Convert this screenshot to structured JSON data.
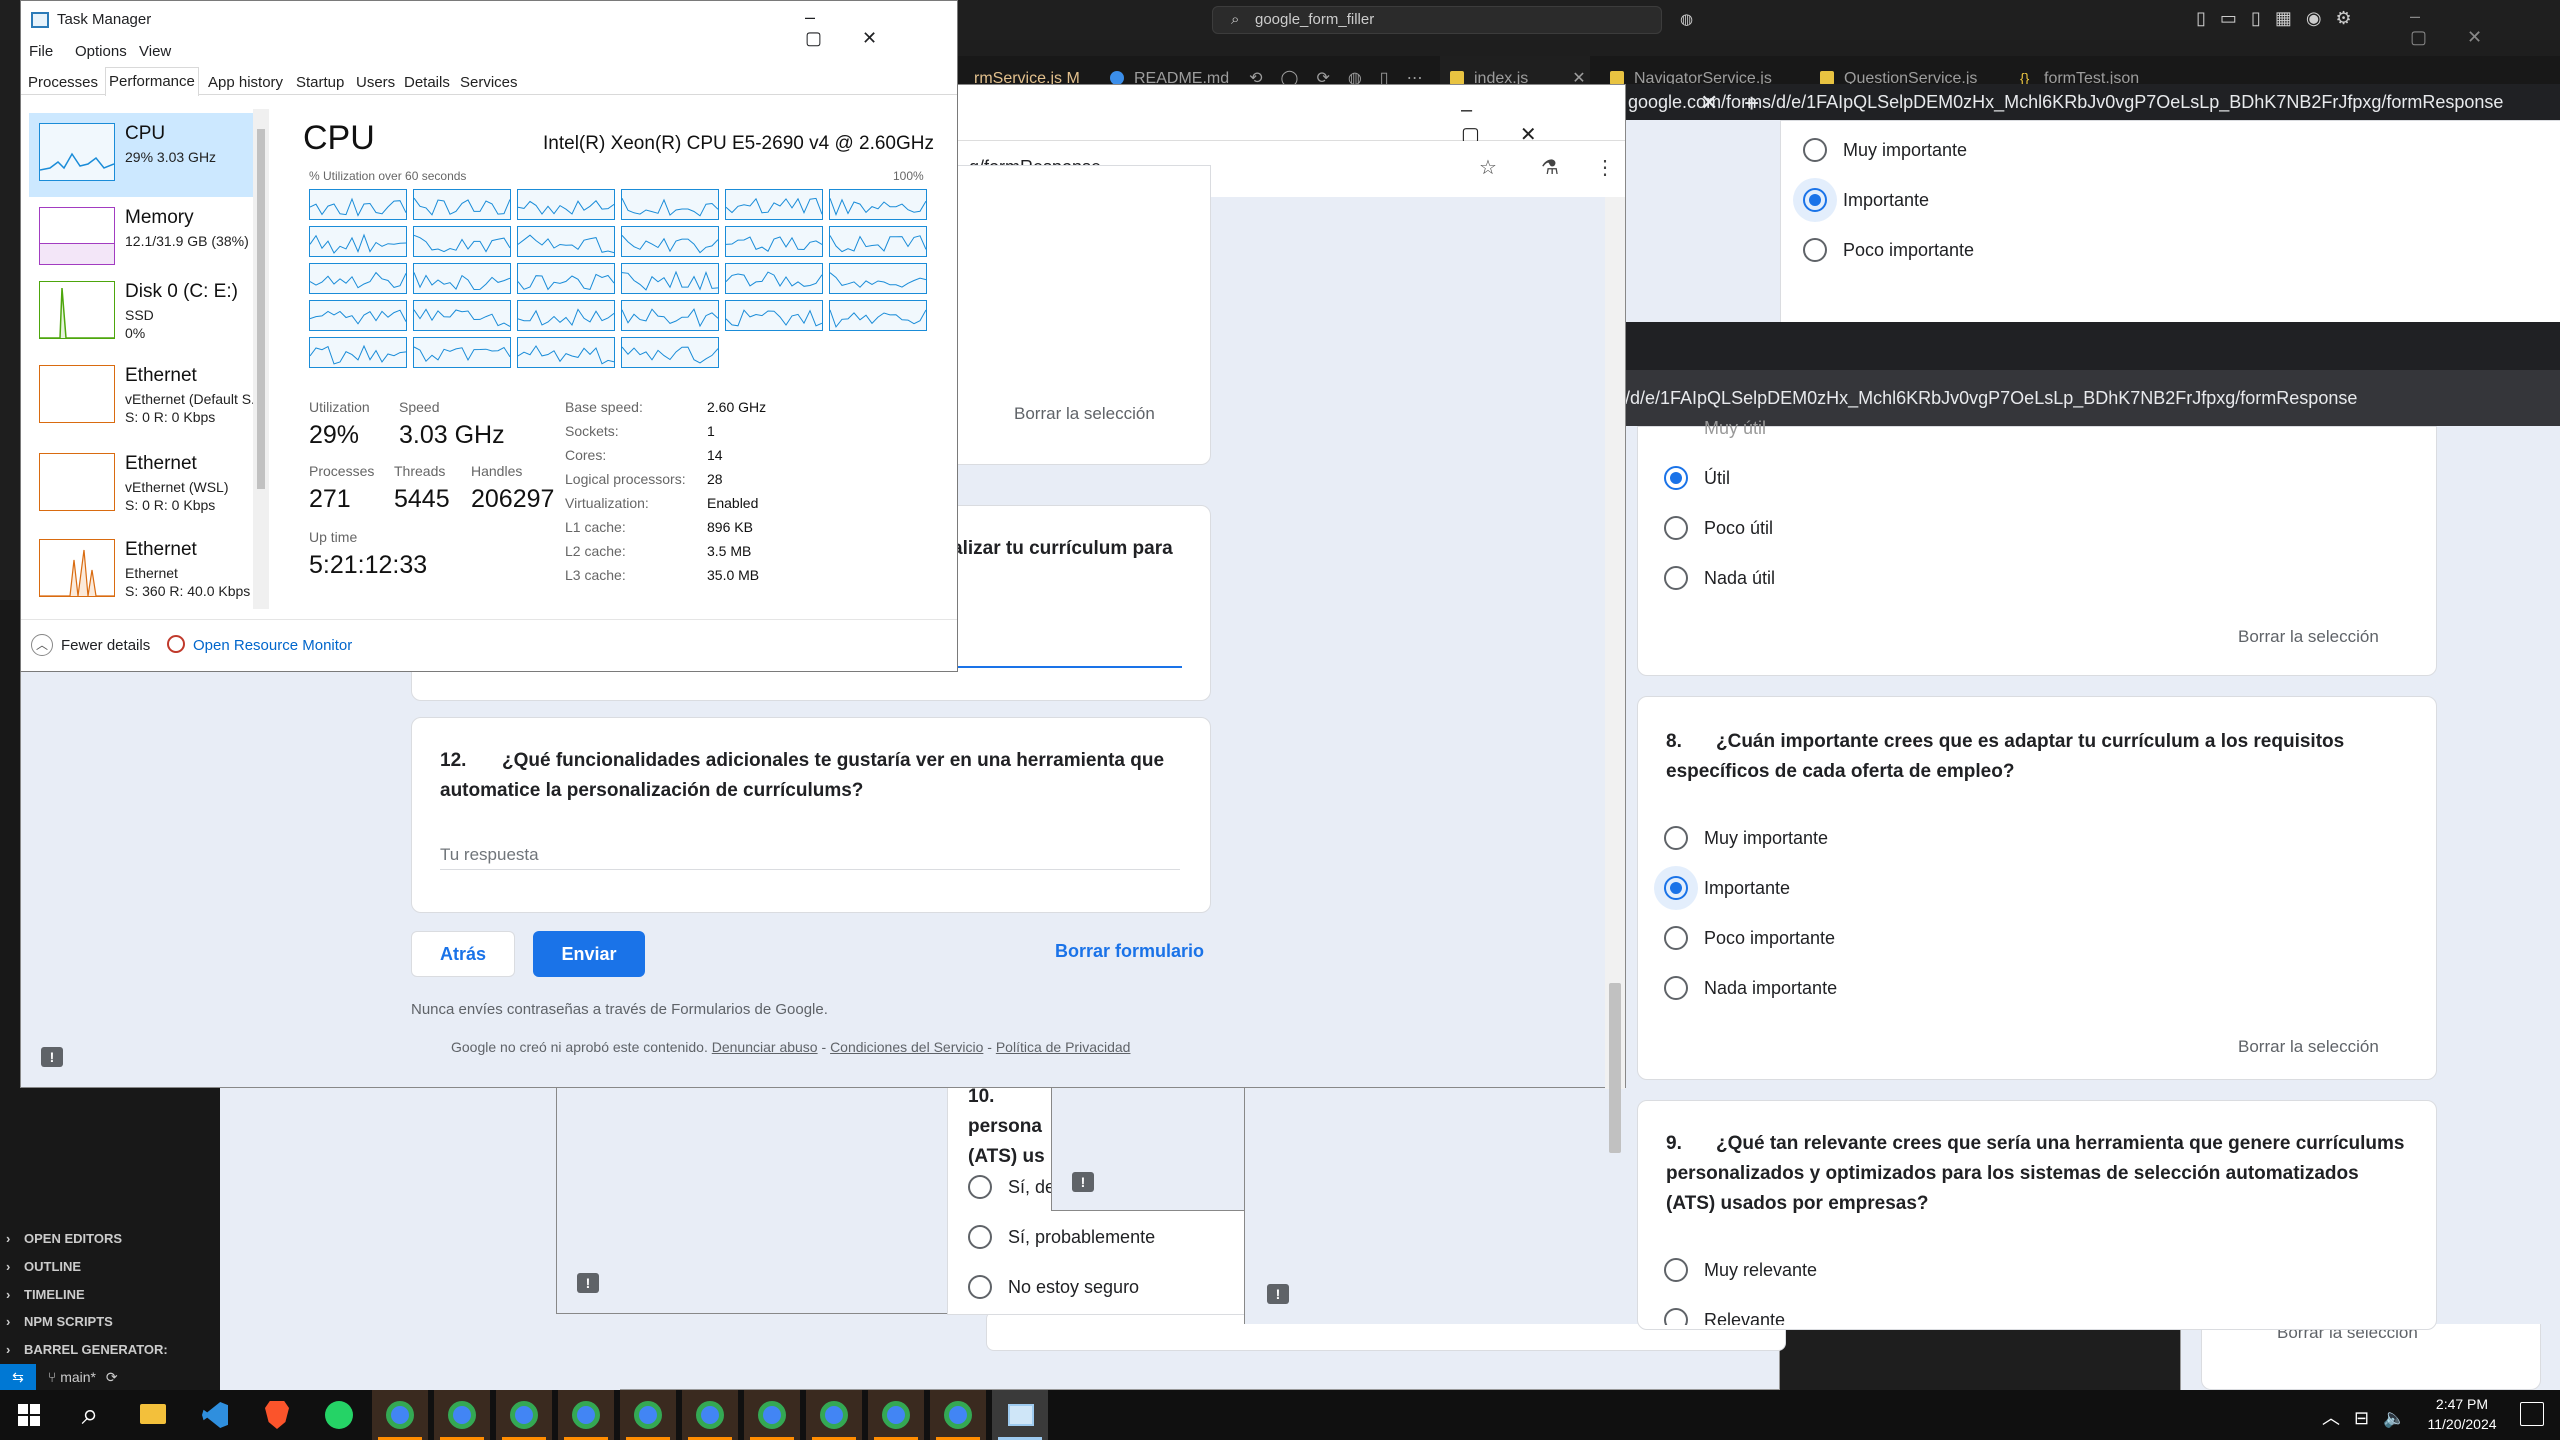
{
  "vscode": {
    "search": "google_form_filler",
    "tabs": [
      {
        "label": "rmService.js M",
        "color": "#e8c341"
      },
      {
        "label": "README.md",
        "color": "#3b8eea"
      },
      {
        "label": "index.js",
        "color": "#e8c341"
      },
      {
        "label": "NavigatorService.js",
        "color": "#e8c341"
      },
      {
        "label": "QuestionService.js",
        "color": "#e8c341"
      },
      {
        "label": "formTest.json",
        "color": "#e8c341"
      }
    ],
    "sections": [
      "OPEN EDITORS",
      "OUTLINE",
      "TIMELINE",
      "NPM SCRIPTS",
      "BARREL GENERATOR: EXPORT"
    ],
    "branch": "main*"
  },
  "task_manager": {
    "title": "Task Manager",
    "menu": [
      "File",
      "Options",
      "View"
    ],
    "tabs": [
      "Processes",
      "Performance",
      "App history",
      "Startup",
      "Users",
      "Details",
      "Services"
    ],
    "sidebar": [
      {
        "name": "CPU",
        "line2": "29% 3.03 GHz",
        "line3": ""
      },
      {
        "name": "Memory",
        "line2": "12.1/31.9 GB (38%)",
        "line3": ""
      },
      {
        "name": "Disk 0 (C: E:)",
        "line2": "SSD",
        "line3": "0%"
      },
      {
        "name": "Ethernet",
        "line2": "vEthernet (Default S...",
        "line3": "S: 0 R: 0 Kbps"
      },
      {
        "name": "Ethernet",
        "line2": "vEthernet (WSL)",
        "line3": "S: 0 R: 0 Kbps"
      },
      {
        "name": "Ethernet",
        "line2": "Ethernet",
        "line3": "S: 360 R: 40.0 Kbps"
      }
    ],
    "heading": "CPU",
    "processor": "Intel(R) Xeon(R) CPU E5-2690 v4 @ 2.60GHz",
    "graph_caption": "% Utilization over 60 seconds",
    "graph_max": "100%",
    "utilization_label": "Utilization",
    "utilization": "29%",
    "speed_label": "Speed",
    "speed": "3.03 GHz",
    "processes_label": "Processes",
    "processes": "271",
    "threads_label": "Threads",
    "threads": "5445",
    "handles_label": "Handles",
    "handles": "206297",
    "uptime_label": "Up time",
    "uptime": "5:21:12:33",
    "specs": [
      {
        "k": "Base speed:",
        "v": "2.60 GHz"
      },
      {
        "k": "Sockets:",
        "v": "1"
      },
      {
        "k": "Cores:",
        "v": "14"
      },
      {
        "k": "Logical processors:",
        "v": "28"
      },
      {
        "k": "Virtualization:",
        "v": "Enabled"
      },
      {
        "k": "L1 cache:",
        "v": "896 KB"
      },
      {
        "k": "L2 cache:",
        "v": "3.5 MB"
      },
      {
        "k": "L3 cache:",
        "v": "35.0 MB"
      }
    ],
    "fewer_details": "Fewer details",
    "resource_monitor": "Open Resource Monitor"
  },
  "form_main": {
    "url_tail": "g/formResponse",
    "clear_selection": "Borrar la selección",
    "q11_partial": "alizar tu currículum para",
    "q12_number": "12.",
    "q12_text": "¿Qué funcionalidades adicionales te gustaría ver en una herramienta que automatice la personalización de currículums?",
    "answer_placeholder": "Tu respuesta",
    "back": "Atrás",
    "submit": "Enviar",
    "clear_form": "Borrar formulario",
    "no_passwords": "Nunca envíes contraseñas a través de Formularios de Google.",
    "footer_prefix": "Google no creó ni aprobó este contenido.",
    "footer_links": [
      "Denunciar abuso",
      "Condiciones del Servicio",
      "Política de Privacidad"
    ]
  },
  "form_right_top": {
    "url": "google.com/forms/d/e/1FAIpQLSelpDEM0zHx_Mchl6KRbJv0vgP7OeLsLp_BDhK7NB2FrJfpxg/formResponse",
    "options": [
      "Muy importante",
      "Importante",
      "Poco importante"
    ],
    "selected": 1
  },
  "form_right": {
    "url": "/d/e/1FAIpQLSelpDEM0zHx_Mchl6KRbJv0vgP7OeLsLp_BDhK7NB2FrJfpxg/formResponse",
    "q7_partial_option": "Muy útil",
    "q7_options": [
      "Útil",
      "Poco útil",
      "Nada útil"
    ],
    "clear_selection": "Borrar la selección",
    "q8_number": "8.",
    "q8_text": "¿Cuán importante crees que es adaptar tu currículum a los requisitos específicos de cada oferta de empleo?",
    "q8_options": [
      "Muy importante",
      "Importante",
      "Poco importante",
      "Nada importante"
    ],
    "q8_selected": 1,
    "q9_number": "9.",
    "q9_text": "¿Qué tan relevante crees que sería una herramienta que genere currículums personalizados y optimizados para los sistemas de selección automatizados (ATS) usados por empresas?",
    "q9_options": [
      "Muy relevante",
      "Relevante"
    ],
    "bottom_clear": "Borrar la selección"
  },
  "form_behind": {
    "q10_number": "10.",
    "q10_partial": "persona",
    "q10_partial2": "(ATS) us",
    "options": [
      "Sí, definitivamente",
      "Sí, probablemente",
      "No estoy seguro"
    ]
  },
  "taskbar": {
    "time": "2:47 PM",
    "date": "11/20/2024"
  }
}
